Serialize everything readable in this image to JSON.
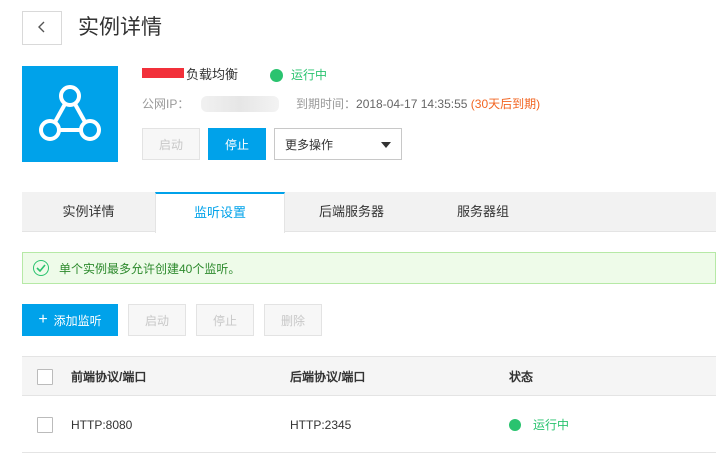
{
  "header": {
    "title": "实例详情"
  },
  "instance": {
    "name_suffix": "负载均衡",
    "status": "运行中",
    "ip_label": "公网IP：",
    "expire_label": "到期时间：",
    "expire_value": "2018-04-17 14:35:55",
    "expire_warning": "(30天后到期)",
    "colors": {
      "brand": "#00a2ea",
      "running": "#2ac36f",
      "warning": "#f26522"
    }
  },
  "actions": {
    "start": "启动",
    "stop": "停止",
    "more": "更多操作"
  },
  "tabs": [
    {
      "label": "实例详情"
    },
    {
      "label": "监听设置"
    },
    {
      "label": "后端服务器"
    },
    {
      "label": "服务器组"
    }
  ],
  "notice": {
    "text": "单个实例最多允许创建40个监听。"
  },
  "listener_actions": {
    "add": "添加监听",
    "start": "启动",
    "stop": "停止",
    "delete": "删除"
  },
  "table": {
    "columns": [
      "前端协议/端口",
      "后端协议/端口",
      "状态"
    ],
    "rows": [
      {
        "front": "HTTP:8080",
        "back": "HTTP:2345",
        "status": "运行中"
      }
    ]
  }
}
